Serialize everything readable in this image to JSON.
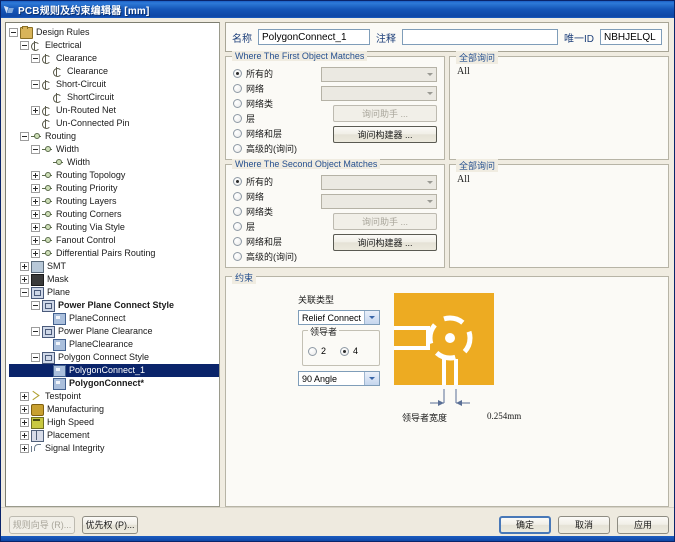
{
  "window": {
    "title": "PCB规则及约束编辑器  [mm]",
    "icon": "pcb-rules-icon"
  },
  "tree": {
    "items": [
      {
        "label": "Design Rules",
        "depth": 0,
        "expander": "minus",
        "icon": "folder-icon",
        "selected": false,
        "bold": false
      },
      {
        "label": "Electrical",
        "depth": 1,
        "expander": "minus",
        "icon": "electrical-icon",
        "selected": false,
        "bold": false
      },
      {
        "label": "Clearance",
        "depth": 2,
        "expander": "minus",
        "icon": "electrical-icon",
        "selected": false,
        "bold": false
      },
      {
        "label": "Clearance",
        "depth": 3,
        "expander": "none",
        "icon": "electrical-icon",
        "selected": false,
        "bold": false
      },
      {
        "label": "Short-Circuit",
        "depth": 2,
        "expander": "minus",
        "icon": "electrical-icon",
        "selected": false,
        "bold": false
      },
      {
        "label": "ShortCircuit",
        "depth": 3,
        "expander": "none",
        "icon": "electrical-icon",
        "selected": false,
        "bold": false
      },
      {
        "label": "Un-Routed Net",
        "depth": 2,
        "expander": "plus",
        "icon": "electrical-icon",
        "selected": false,
        "bold": false
      },
      {
        "label": "Un-Connected Pin",
        "depth": 2,
        "expander": "none",
        "icon": "electrical-icon",
        "selected": false,
        "bold": false
      },
      {
        "label": "Routing",
        "depth": 1,
        "expander": "minus",
        "icon": "routing-icon",
        "selected": false,
        "bold": false
      },
      {
        "label": "Width",
        "depth": 2,
        "expander": "minus",
        "icon": "routing-icon",
        "selected": false,
        "bold": false
      },
      {
        "label": "Width",
        "depth": 3,
        "expander": "none",
        "icon": "routing-icon",
        "selected": false,
        "bold": false
      },
      {
        "label": "Routing Topology",
        "depth": 2,
        "expander": "plus",
        "icon": "routing-icon",
        "selected": false,
        "bold": false
      },
      {
        "label": "Routing Priority",
        "depth": 2,
        "expander": "plus",
        "icon": "routing-icon",
        "selected": false,
        "bold": false
      },
      {
        "label": "Routing Layers",
        "depth": 2,
        "expander": "plus",
        "icon": "routing-icon",
        "selected": false,
        "bold": false
      },
      {
        "label": "Routing Corners",
        "depth": 2,
        "expander": "plus",
        "icon": "routing-icon",
        "selected": false,
        "bold": false
      },
      {
        "label": "Routing Via Style",
        "depth": 2,
        "expander": "plus",
        "icon": "routing-icon",
        "selected": false,
        "bold": false
      },
      {
        "label": "Fanout Control",
        "depth": 2,
        "expander": "plus",
        "icon": "routing-icon",
        "selected": false,
        "bold": false
      },
      {
        "label": "Differential Pairs Routing",
        "depth": 2,
        "expander": "plus",
        "icon": "routing-icon",
        "selected": false,
        "bold": false
      },
      {
        "label": "SMT",
        "depth": 1,
        "expander": "plus",
        "icon": "smt-icon",
        "selected": false,
        "bold": false
      },
      {
        "label": "Mask",
        "depth": 1,
        "expander": "plus",
        "icon": "mask-icon",
        "selected": false,
        "bold": false
      },
      {
        "label": "Plane",
        "depth": 1,
        "expander": "minus",
        "icon": "plane-icon",
        "selected": false,
        "bold": false
      },
      {
        "label": "Power Plane Connect Style",
        "depth": 2,
        "expander": "minus",
        "icon": "plane-icon",
        "selected": false,
        "bold": true
      },
      {
        "label": "PlaneConnect",
        "depth": 3,
        "expander": "none",
        "icon": "polygon-icon",
        "selected": false,
        "bold": false
      },
      {
        "label": "Power Plane Clearance",
        "depth": 2,
        "expander": "minus",
        "icon": "plane-icon",
        "selected": false,
        "bold": false
      },
      {
        "label": "PlaneClearance",
        "depth": 3,
        "expander": "none",
        "icon": "polygon-icon",
        "selected": false,
        "bold": false
      },
      {
        "label": "Polygon Connect Style",
        "depth": 2,
        "expander": "minus",
        "icon": "plane-icon",
        "selected": false,
        "bold": false
      },
      {
        "label": "PolygonConnect_1",
        "depth": 3,
        "expander": "none",
        "icon": "polygon-icon",
        "selected": true,
        "bold": false
      },
      {
        "label": "PolygonConnect*",
        "depth": 3,
        "expander": "none",
        "icon": "polygon-icon",
        "selected": false,
        "bold": true
      },
      {
        "label": "Testpoint",
        "depth": 1,
        "expander": "plus",
        "icon": "testpoint-icon",
        "selected": false,
        "bold": false
      },
      {
        "label": "Manufacturing",
        "depth": 1,
        "expander": "plus",
        "icon": "manufacturing-icon",
        "selected": false,
        "bold": false
      },
      {
        "label": "High Speed",
        "depth": 1,
        "expander": "plus",
        "icon": "highspeed-icon",
        "selected": false,
        "bold": false
      },
      {
        "label": "Placement",
        "depth": 1,
        "expander": "plus",
        "icon": "placement-icon",
        "selected": false,
        "bold": false
      },
      {
        "label": "Signal Integrity",
        "depth": 1,
        "expander": "plus",
        "icon": "signal-icon",
        "selected": false,
        "bold": false
      }
    ]
  },
  "header": {
    "name_label": "名称",
    "name_value": "PolygonConnect_1",
    "comment_label": "注释",
    "comment_value": "",
    "uid_label": "唯一ID",
    "uid_value": "NBHJELQL"
  },
  "first_match": {
    "caption": "Where The First Object Matches",
    "options": [
      {
        "label": "所有的",
        "selected": true
      },
      {
        "label": "网络",
        "selected": false
      },
      {
        "label": "网络类",
        "selected": false
      },
      {
        "label": "层",
        "selected": false
      },
      {
        "label": "网络和层",
        "selected": false
      },
      {
        "label": "高级的(询问)",
        "selected": false
      }
    ],
    "combo_net_value": "",
    "combo_class_value": "",
    "helper_button": "询问助手 ...",
    "builder_button": "询问构建器 ..."
  },
  "first_query": {
    "caption": "全部询问",
    "text": "All"
  },
  "second_match": {
    "caption": "Where The Second Object Matches",
    "options": [
      {
        "label": "所有的",
        "selected": true
      },
      {
        "label": "网络",
        "selected": false
      },
      {
        "label": "网络类",
        "selected": false
      },
      {
        "label": "层",
        "selected": false
      },
      {
        "label": "网络和层",
        "selected": false
      },
      {
        "label": "高级的(询问)",
        "selected": false
      }
    ],
    "combo_net_value": "",
    "combo_class_value": "",
    "helper_button": "询问助手 ...",
    "builder_button": "询问构建器 ..."
  },
  "second_query": {
    "caption": "全部询问",
    "text": "All"
  },
  "constraint": {
    "caption": "约束",
    "connect_type_label": "关联类型",
    "connect_type_value": "Relief Connect",
    "leader_label": "领导者",
    "leader_options": [
      {
        "label": "2",
        "selected": false
      },
      {
        "label": "4",
        "selected": true
      }
    ],
    "angle_value": "90 Angle",
    "dimension_label": "领导者宽度",
    "dimension_value": "0.254mm",
    "art_fill_color": "#edab22",
    "art_relief_color": "#ffffff"
  },
  "footer": {
    "wizard_button": "规则向导 (R)...",
    "priority_button": "优先权 (P)...",
    "ok_button": "确定",
    "cancel_button": "取消",
    "apply_button": "应用"
  }
}
